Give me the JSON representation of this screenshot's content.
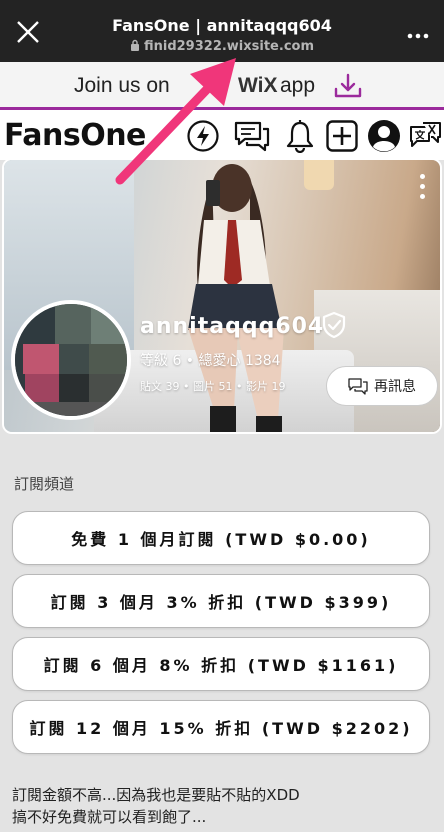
{
  "browser": {
    "title": "FansOne | annitaqqq604",
    "url": "finid29322.wixsite.com",
    "icons": [
      "close-icon",
      "lock-icon",
      "more-icon"
    ]
  },
  "banner": {
    "text": "Join us on",
    "wix": "WiX",
    "app": "app",
    "accent_color": "#9b2a9c"
  },
  "header": {
    "logo": "FansOne",
    "icons": [
      "lightning-icon",
      "chat-icon",
      "bell-icon",
      "add-icon",
      "profile-icon",
      "translate-icon"
    ]
  },
  "profile": {
    "username": "annitaqqq604",
    "level_line": "等級 6 • 總愛心 1384",
    "counts_line": "貼文 39 • 圖片 51 • 影片 19",
    "message_button": "再訊息"
  },
  "subscriptions": {
    "title": "訂閱頻道",
    "options": [
      "免費 1 個月訂閱 (TWD $0.00)",
      "訂閱 3 個月 3% 折扣 (TWD $399)",
      "訂閱 6 個月 8% 折扣 (TWD $1161)",
      "訂閱 12 個月 15% 折扣 (TWD $2202)"
    ]
  },
  "description": {
    "line1": "訂閱金額不高...因為我也是要貼不貼的XDD",
    "line2": "搞不好免費就可以看到飽了..."
  },
  "colors": {
    "arrow": "#f0367a",
    "topbar": "#232323"
  }
}
